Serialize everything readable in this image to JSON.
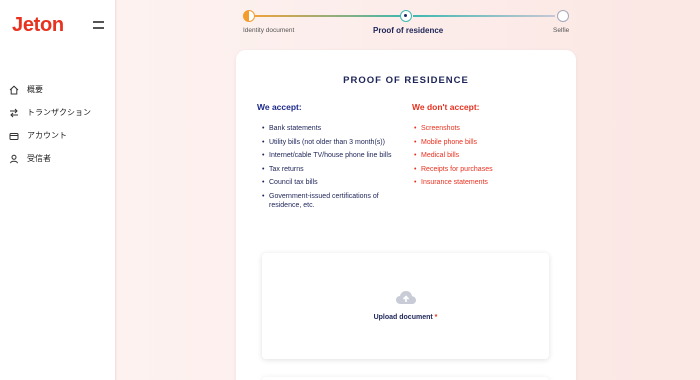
{
  "app": {
    "logo_text": "Jeton",
    "brand_color": "#e8311f"
  },
  "sidebar": {
    "items": [
      {
        "label": "概要",
        "icon": "home-icon"
      },
      {
        "label": "トランザクション",
        "icon": "transfer-arrows-icon"
      },
      {
        "label": "アカウント",
        "icon": "wallet-icon"
      },
      {
        "label": "受信者",
        "icon": "user-icon"
      }
    ]
  },
  "stepper": {
    "steps": [
      {
        "label": "Identity document",
        "state": "in-progress"
      },
      {
        "label": "Proof of residence",
        "state": "current"
      },
      {
        "label": "Selfie",
        "state": "pending"
      }
    ]
  },
  "card": {
    "title": "PROOF OF RESIDENCE",
    "accept_heading": "We accept:",
    "reject_heading": "We don't accept:",
    "accept_items": [
      "Bank statements",
      "Utility bills (not older than 3 month(s))",
      "Internet/cable TV/house phone line bills",
      "Tax returns",
      "Council tax bills",
      "Government-issued certifications of residence, etc."
    ],
    "reject_items": [
      "Screenshots",
      "Mobile phone bills",
      "Medical bills",
      "Receipts for purchases",
      "Insurance statements"
    ],
    "upload_label": "Upload document",
    "upload_required_mark": "*",
    "upload_icon": "cloud-upload-icon"
  }
}
